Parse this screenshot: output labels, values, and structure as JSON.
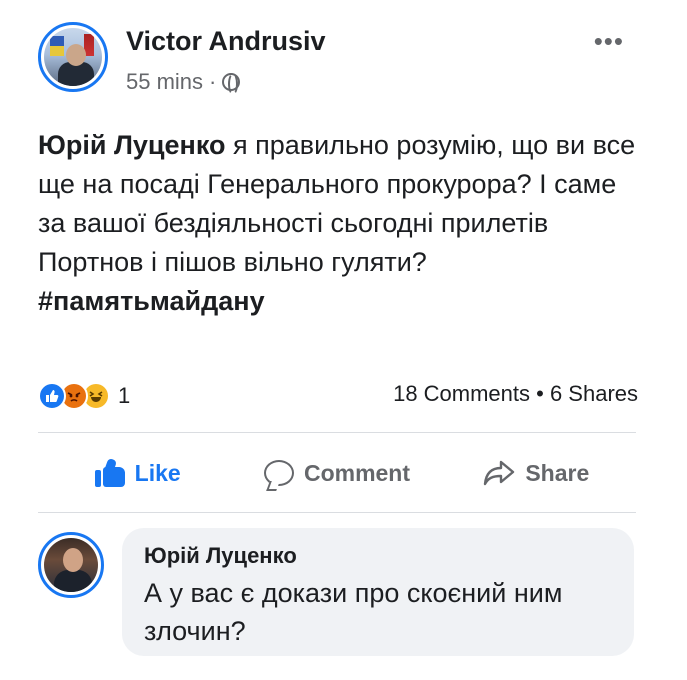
{
  "post": {
    "author": "Victor Andrusiv",
    "time": "55 mins",
    "separator": "·",
    "more_label": "•••",
    "mention": "Юрій Луценко",
    "body_text": " я правильно розумію, що ви все ще на посаді Генерального прокурора? І саме за вашої бездіяльності сьогодні прилетів Портнов і пішов вільно гуляти?",
    "hashtag": "#памятьмайдану"
  },
  "stats": {
    "reactions": [
      "like",
      "angry",
      "haha"
    ],
    "reaction_count": "1",
    "counts_text": "18 Comments • 6 Shares"
  },
  "actions": {
    "like_label": "Like",
    "comment_label": "Comment",
    "share_label": "Share"
  },
  "comment": {
    "author": "Юрій Луценко",
    "text": "А у вас є докази про скоєний ним злочин?"
  },
  "colors": {
    "accent": "#1877f2",
    "secondary_text": "#65676b",
    "comment_bubble": "#f0f2f5"
  }
}
